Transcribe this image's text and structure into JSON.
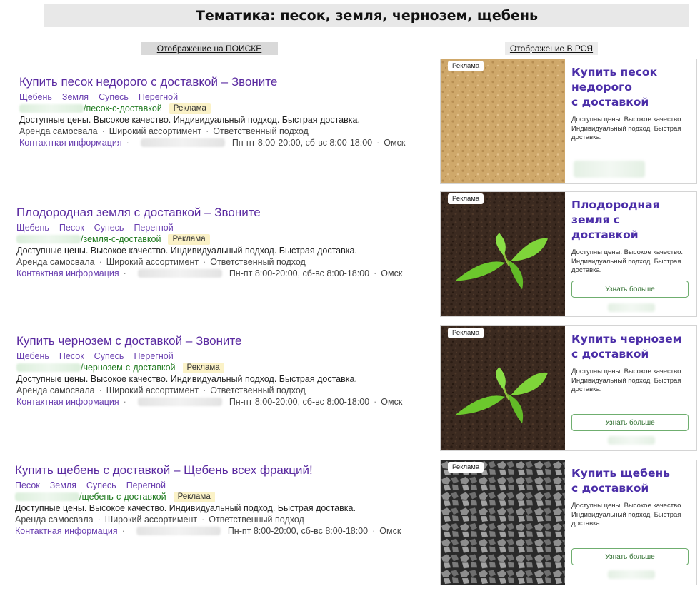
{
  "header": {
    "title": "Тематика: песок, земля, чернозем, щебень"
  },
  "sections": {
    "search_label": "Отображение на ПОИСКЕ",
    "rsya_label": "Отображение В РСЯ"
  },
  "common": {
    "ad_badge": "Реклама",
    "description": "Доступные цены. Высокое качество. Индивидуальный подход. Быстрая доставка.",
    "features": [
      "Аренда самосвала",
      "Широкий ассортимент",
      "Ответственный подход"
    ],
    "contact_link": "Контактная информация",
    "hours": "Пн-пт 8:00-20:00, сб-вс 8:00-18:00",
    "city": "Омск",
    "card_desc": "Доступны цены. Высокое качество. Индивидуальный подход. Быстрая доставка.",
    "card_button": "Узнать больше",
    "dot": "·"
  },
  "search_ads": [
    {
      "title": "Купить песок недорого с доставкой – Звоните",
      "sitelinks": [
        "Щебень",
        "Земля",
        "Супесь",
        "Перегной"
      ],
      "path": "/песок-с-доставкой"
    },
    {
      "title": "Плодородная земля с доставкой – Звоните",
      "sitelinks": [
        "Щебень",
        "Песок",
        "Супесь",
        "Перегной"
      ],
      "path": "/земля-с-доставкой"
    },
    {
      "title": "Купить чернозем с доставкой – Звоните",
      "sitelinks": [
        "Щебень",
        "Песок",
        "Супесь",
        "Перегной"
      ],
      "path": "/чернозем-с-доставкой"
    },
    {
      "title": "Купить щебень с доставкой – Щебень всех фракций!",
      "sitelinks": [
        "Песок",
        "Земля",
        "Супесь",
        "Перегной"
      ],
      "path": "/щебень-с-доставкой"
    }
  ],
  "rsya_cards": [
    {
      "title_lines": [
        "Купить песок",
        "недорого",
        "с доставкой"
      ],
      "image": "sand-image",
      "has_button": false
    },
    {
      "title_lines": [
        "Плодородная",
        "земля с доставкой"
      ],
      "image": "soil-sprout-image",
      "has_button": true
    },
    {
      "title_lines": [
        "Купить чернозем",
        "с доставкой"
      ],
      "image": "soil-sprout-image",
      "has_button": true
    },
    {
      "title_lines": [
        "Купить щебень",
        "с доставкой"
      ],
      "image": "gravel-image",
      "has_button": true
    }
  ],
  "colors": {
    "title_link": "#5a2aa0",
    "url_green": "#1f7a1f",
    "badge_bg": "#fbf2c7",
    "card_title": "#4b2ea8"
  }
}
